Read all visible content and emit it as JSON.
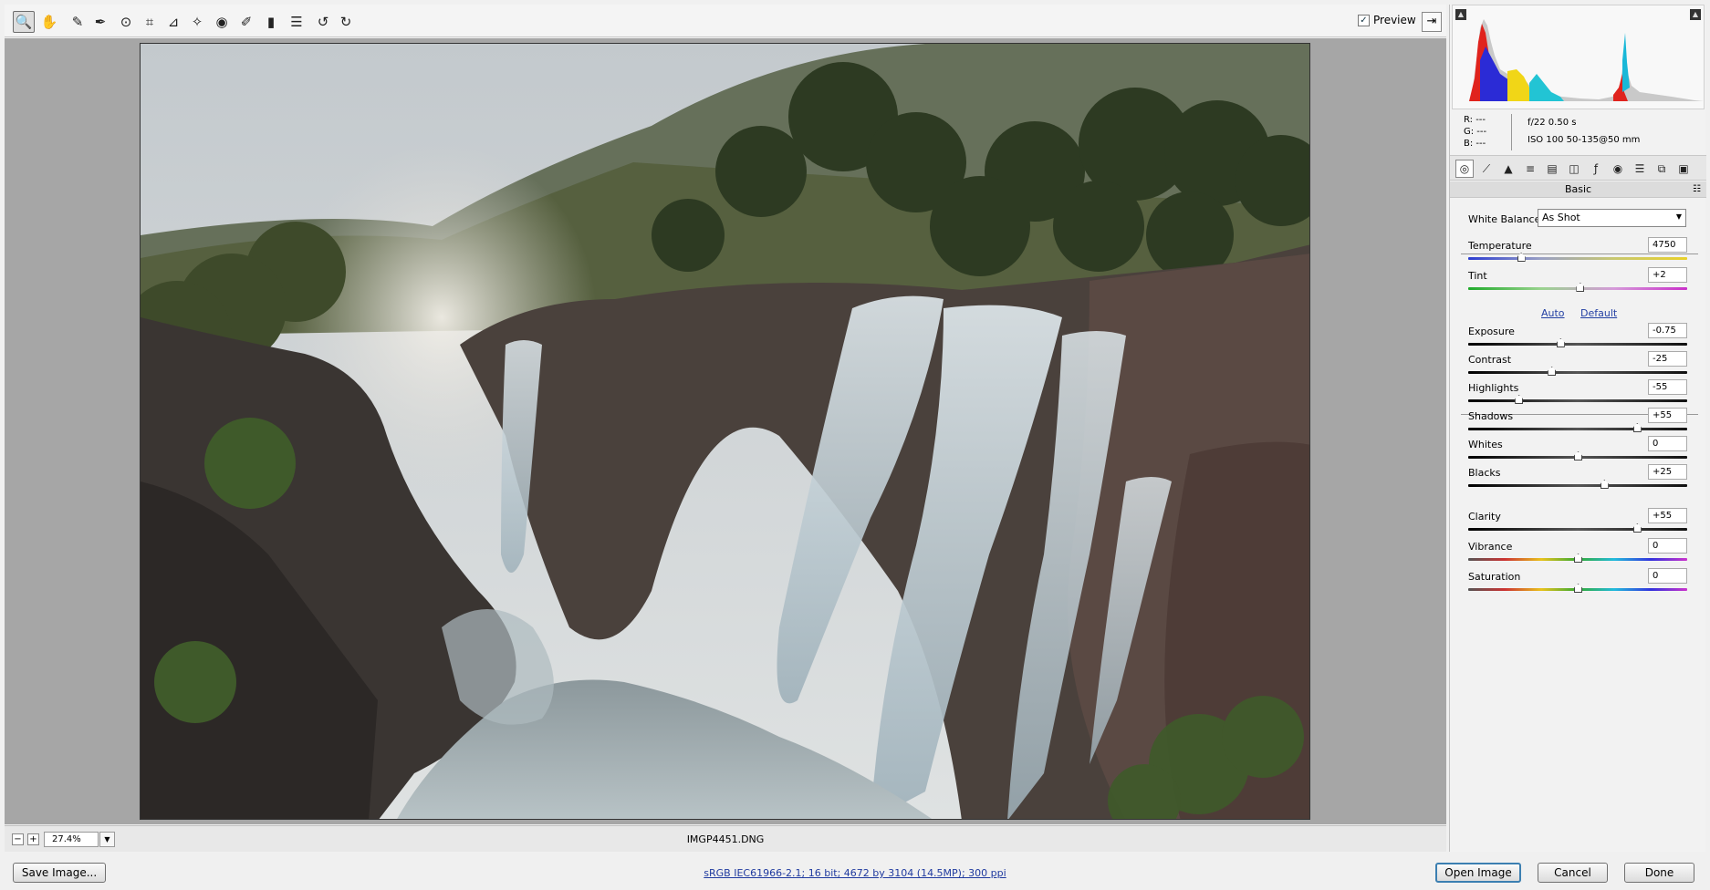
{
  "toolbar": {
    "tools": [
      {
        "name": "zoom-tool",
        "icon": "🔍",
        "active": true
      },
      {
        "name": "hand-tool",
        "icon": "✋"
      },
      {
        "name": "white-balance-tool",
        "icon": "✎"
      },
      {
        "name": "color-sampler-tool",
        "icon": "✒"
      },
      {
        "name": "targeted-adjustment-tool",
        "icon": "⊙"
      },
      {
        "name": "crop-tool",
        "icon": "⌗"
      },
      {
        "name": "straighten-tool",
        "icon": "⊿"
      },
      {
        "name": "spot-removal-tool",
        "icon": "✧"
      },
      {
        "name": "red-eye-tool",
        "icon": "◉"
      },
      {
        "name": "adjustment-brush-tool",
        "icon": "✐"
      },
      {
        "name": "graduated-filter-tool",
        "icon": "▮"
      },
      {
        "name": "preferences-tool",
        "icon": "☰"
      },
      {
        "name": "rotate-left-tool",
        "icon": "↺"
      },
      {
        "name": "rotate-right-tool",
        "icon": "↻"
      }
    ],
    "preview_label": "Preview",
    "preview_checked": true
  },
  "status": {
    "zoom_value": "27.4%",
    "filename": "IMGP4451.DNG"
  },
  "info": {
    "r": "R:  ---",
    "g": "G:  ---",
    "b": "B:  ---",
    "aperture_shutter": "f/22    0.50 s",
    "iso_lens": "ISO 100    50-135@50 mm"
  },
  "panel": {
    "section_title": "Basic",
    "tabs": [
      "basic-tab",
      "tone-curve-tab",
      "detail-tab",
      "hsl-tab",
      "split-toning-tab",
      "lens-corrections-tab",
      "effects-tab",
      "camera-calibration-tab",
      "presets-tab",
      "snapshots-tab",
      "settings-tab"
    ],
    "white_balance_label": "White Balance:",
    "white_balance_value": "As Shot",
    "auto_label": "Auto",
    "default_label": "Default"
  },
  "sliders": [
    {
      "key": "temperature",
      "label": "Temperature",
      "value": "4750",
      "pos": 0.24,
      "track": "temp"
    },
    {
      "key": "tint",
      "label": "Tint",
      "value": "+2",
      "pos": 0.51,
      "track": "tint"
    },
    {
      "key": "exposure",
      "label": "Exposure",
      "value": "-0.75",
      "pos": 0.42,
      "track": "gray"
    },
    {
      "key": "contrast",
      "label": "Contrast",
      "value": "-25",
      "pos": 0.38,
      "track": "gray"
    },
    {
      "key": "highlights",
      "label": "Highlights",
      "value": "-55",
      "pos": 0.23,
      "track": "gray"
    },
    {
      "key": "shadows",
      "label": "Shadows",
      "value": "+55",
      "pos": 0.77,
      "track": "gray"
    },
    {
      "key": "whites",
      "label": "Whites",
      "value": "0",
      "pos": 0.5,
      "track": "gray"
    },
    {
      "key": "blacks",
      "label": "Blacks",
      "value": "+25",
      "pos": 0.62,
      "track": "gray"
    },
    {
      "key": "clarity",
      "label": "Clarity",
      "value": "+55",
      "pos": 0.77,
      "track": "gray"
    },
    {
      "key": "vibrance",
      "label": "Vibrance",
      "value": "0",
      "pos": 0.5,
      "track": "rainbow"
    },
    {
      "key": "saturation",
      "label": "Saturation",
      "value": "0",
      "pos": 0.5,
      "track": "rainbow"
    }
  ],
  "bottom": {
    "save_label": "Save Image...",
    "workflow_options": "sRGB IEC61966-2.1; 16 bit; 4672 by 3104 (14.5MP); 300 ppi",
    "open_label": "Open Image",
    "cancel_label": "Cancel",
    "done_label": "Done"
  }
}
